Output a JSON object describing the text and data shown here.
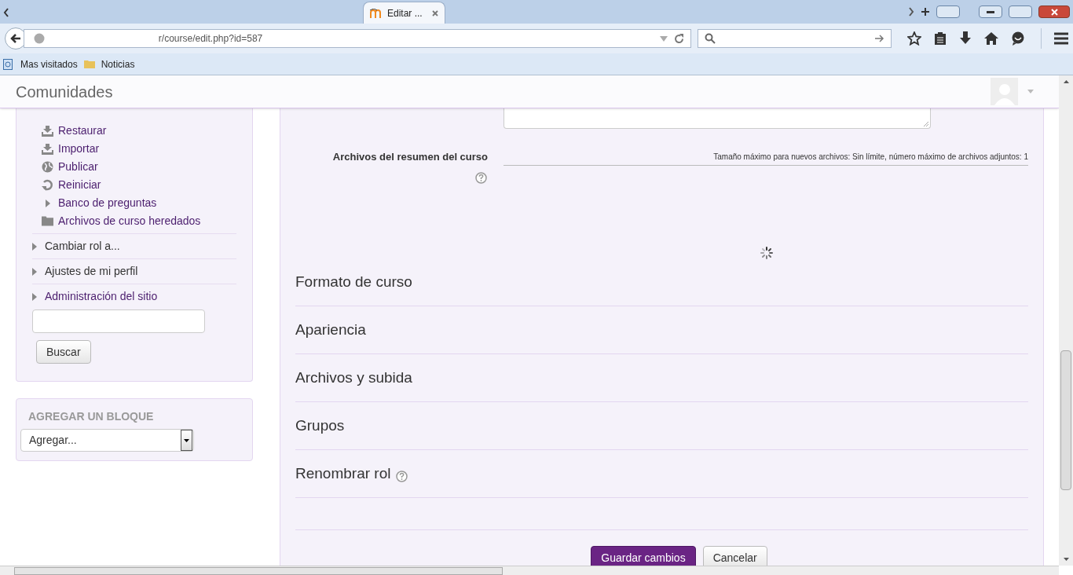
{
  "browser": {
    "tabs": [
      {
        "label": "Editar ...",
        "selected": true
      }
    ],
    "url": "r/course/edit.php?id=587",
    "bookmarks": [
      "Mas visitados",
      "Noticias"
    ]
  },
  "site_name": "Comunidades",
  "sidebar": {
    "admin_items": [
      {
        "label": "Restaurar",
        "kind": "restore"
      },
      {
        "label": "Importar",
        "kind": "restore"
      },
      {
        "label": "Publicar",
        "kind": "globe"
      },
      {
        "label": "Reiniciar",
        "kind": "reset"
      },
      {
        "label": "Banco de preguntas",
        "kind": "branch"
      },
      {
        "label": "Archivos de curso heredados",
        "kind": "folder"
      }
    ],
    "nav_items": [
      {
        "label": "Cambiar rol a...",
        "kind": "section"
      },
      {
        "label": "Ajustes de mi perfil",
        "kind": "section"
      },
      {
        "label": "Administración del sitio",
        "kind": "link"
      }
    ],
    "search_button": "Buscar"
  },
  "add_block": {
    "title": "AGREGAR UN BLOQUE",
    "select_value": "Agregar..."
  },
  "form": {
    "file_field": {
      "label": "Archivos del resumen del curso",
      "info": "Tamaño máximo para nuevos archivos: Sin límite, número máximo de archivos adjuntos: 1"
    },
    "sections": [
      {
        "title": "Formato de curso",
        "help": false
      },
      {
        "title": "Apariencia",
        "help": false
      },
      {
        "title": "Archivos y subida",
        "help": false
      },
      {
        "title": "Grupos",
        "help": false
      },
      {
        "title": "Renombrar rol",
        "help": true
      }
    ],
    "buttons": [
      {
        "label": "Guardar cambios",
        "kind": "primary"
      },
      {
        "label": "Cancelar",
        "kind": "secondary"
      }
    ]
  }
}
